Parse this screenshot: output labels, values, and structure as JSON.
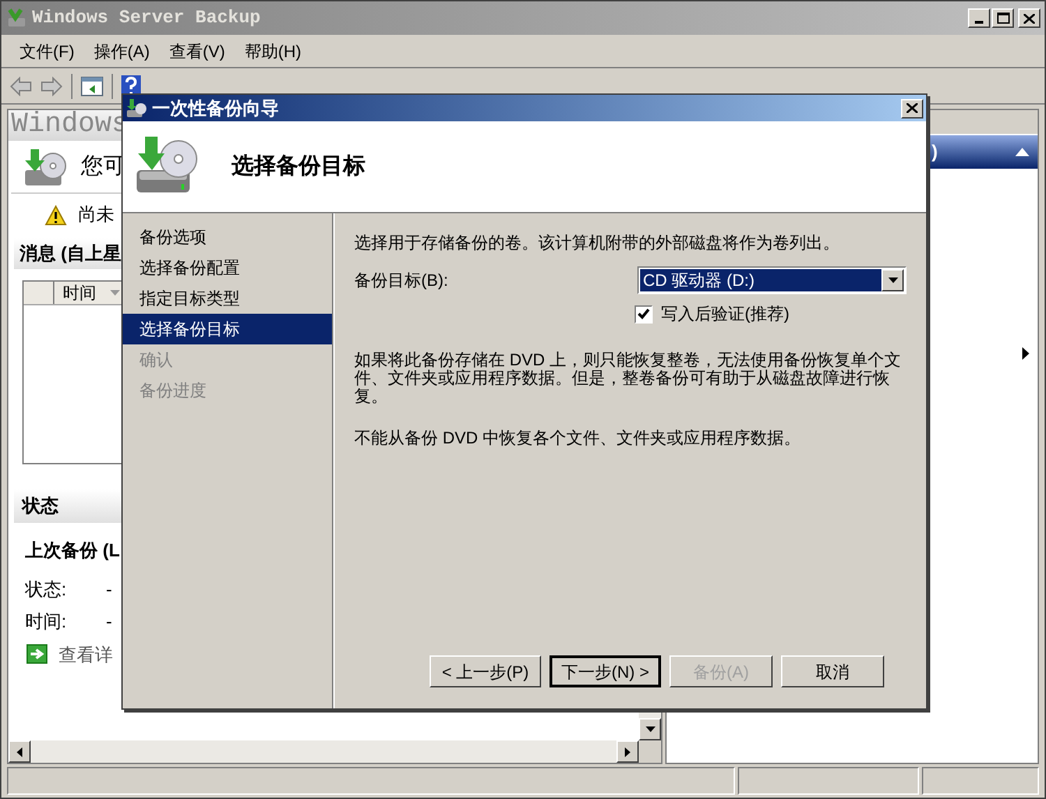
{
  "window": {
    "title": "Windows Server Backup"
  },
  "menu": [
    {
      "label": "文件(F)"
    },
    {
      "label": "操作(A)"
    },
    {
      "label": "查看(V)"
    },
    {
      "label": "帮助(H)"
    }
  ],
  "left_pane": {
    "header": "Windows",
    "intro": "您可",
    "warning": "尚未",
    "messages": {
      "title": "消息 (自上星",
      "columns": [
        "时间"
      ]
    },
    "status": {
      "title": "状态",
      "last_backup": "上次备份 (L",
      "fields": [
        {
          "label": "状态:",
          "value": "-"
        },
        {
          "label": "时间:",
          "value": "-"
        }
      ],
      "link": "查看详"
    }
  },
  "right_pane": {
    "header": ")"
  },
  "dialog": {
    "title": "一次性备份向导",
    "heading": "选择备份目标",
    "steps": [
      {
        "label": "备份选项",
        "selected": false,
        "disabled": false
      },
      {
        "label": "选择备份配置",
        "selected": false,
        "disabled": false
      },
      {
        "label": "指定目标类型",
        "selected": false,
        "disabled": false
      },
      {
        "label": "选择备份目标",
        "selected": true,
        "disabled": false
      },
      {
        "label": "确认",
        "selected": false,
        "disabled": true
      },
      {
        "label": "备份进度",
        "selected": false,
        "disabled": true
      }
    ],
    "description": "选择用于存储备份的卷。该计算机附带的外部磁盘将作为卷列出。",
    "destination": {
      "label": "备份目标(B):",
      "value": "CD 驱动器 (D:)"
    },
    "verify": {
      "label": "写入后验证(推荐)",
      "checked": true
    },
    "note": "如果将此备份存储在 DVD 上，则只能恢复整卷，无法使用备份恢复单个文件、文件夹或应用程序数据。但是，整卷备份可有助于从磁盘故障进行恢复。",
    "note_2": "不能从备份 DVD 中恢复各个文件、文件夹或应用程序数据。",
    "buttons": [
      {
        "label": "< 上一步(P)",
        "disabled": false,
        "default": false
      },
      {
        "label": "下一步(N) >",
        "disabled": false,
        "default": true
      },
      {
        "label": "备份(A)",
        "disabled": true,
        "default": false
      },
      {
        "label": "取消",
        "disabled": false,
        "default": false
      }
    ]
  }
}
